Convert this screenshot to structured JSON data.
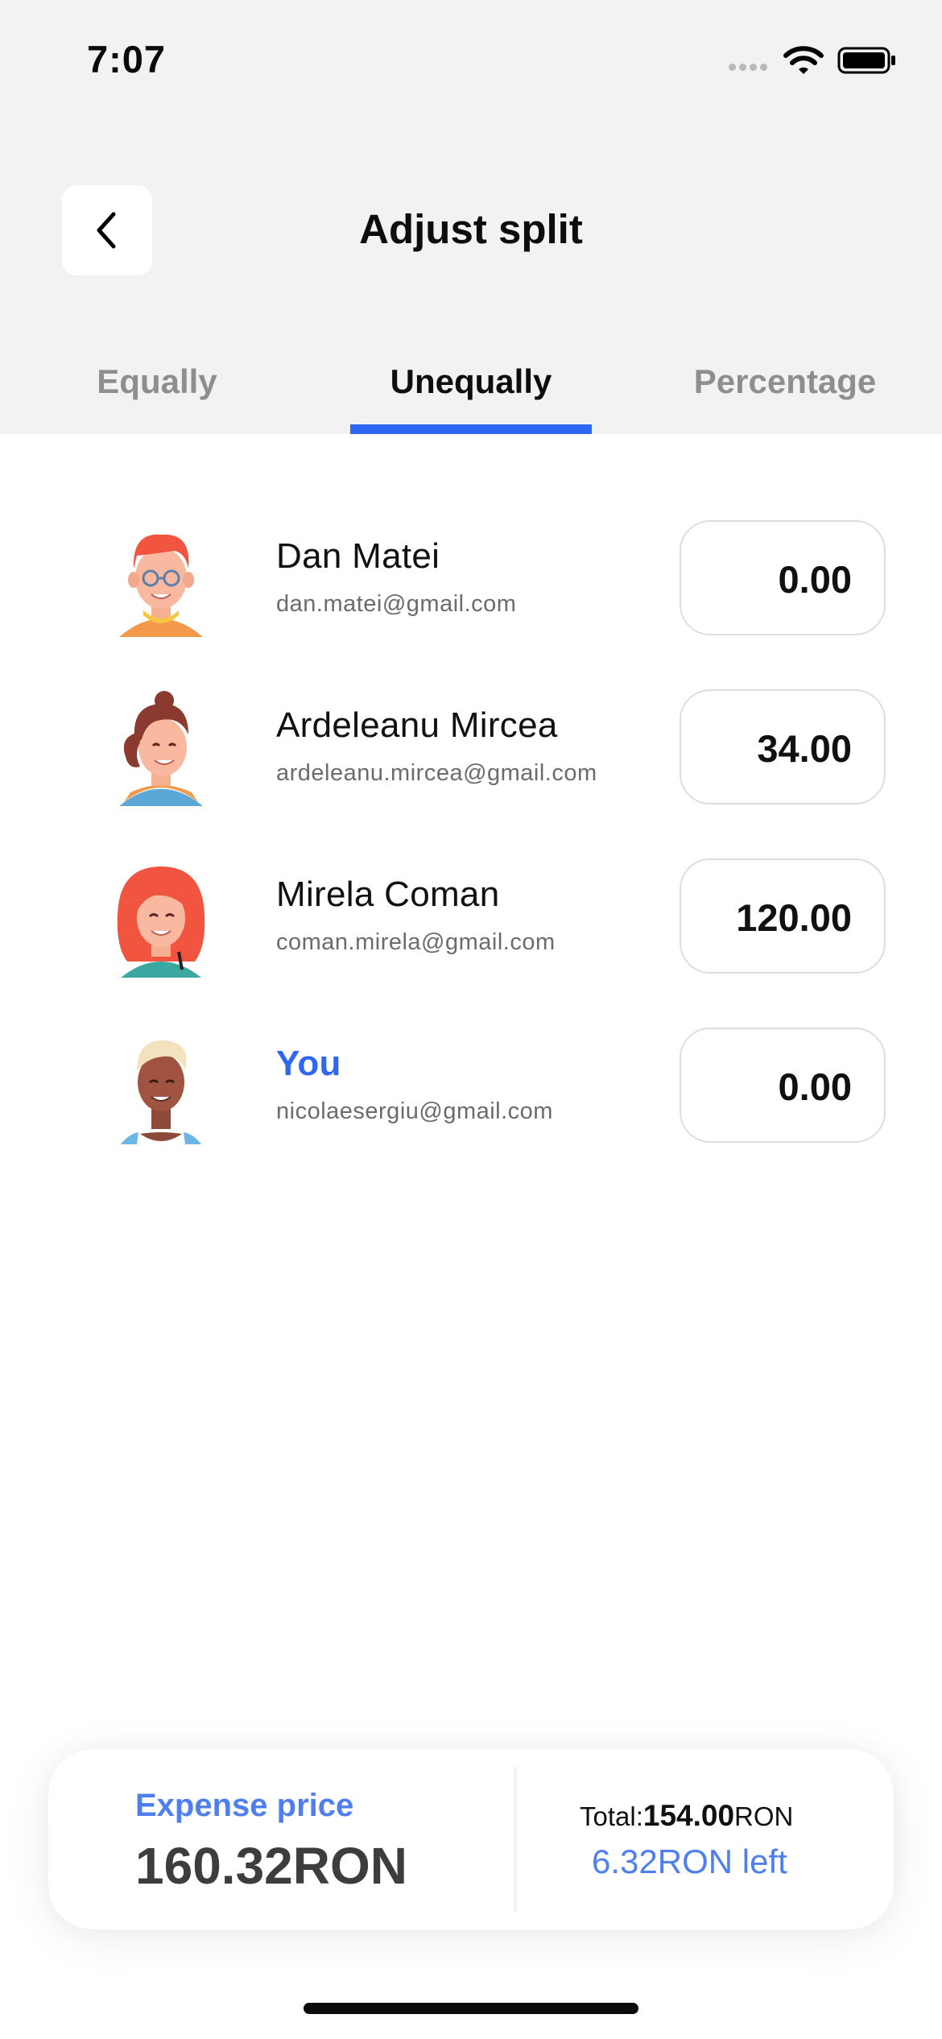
{
  "status_bar": {
    "time": "7:07"
  },
  "header": {
    "title": "Adjust split"
  },
  "tabs": [
    {
      "label": "Equally",
      "active": false
    },
    {
      "label": "Unequally",
      "active": true
    },
    {
      "label": "Percentage",
      "active": false
    }
  ],
  "people": [
    {
      "name": "Dan Matei",
      "email": "dan.matei@gmail.com",
      "amount": "0.00",
      "is_you": false
    },
    {
      "name": "Ardeleanu Mircea",
      "email": "ardeleanu.mircea@gmail.com",
      "amount": "34.00",
      "is_you": false
    },
    {
      "name": "Mirela Coman",
      "email": "coman.mirela@gmail.com",
      "amount": "120.00",
      "is_you": false
    },
    {
      "name": "You",
      "email": "nicolaesergiu@gmail.com",
      "amount": "0.00",
      "is_you": true
    }
  ],
  "summary": {
    "expense_label": "Expense price",
    "expense_value": "160.32RON",
    "total_prefix": "Total:",
    "total_value": "154.00",
    "total_suffix": "RON",
    "left_text": "6.32RON left"
  },
  "colors": {
    "accent": "#2f66f4",
    "accent_soft": "#4f7fee",
    "header_bg": "#f2f2f2",
    "muted_text": "#8e8e8e"
  }
}
